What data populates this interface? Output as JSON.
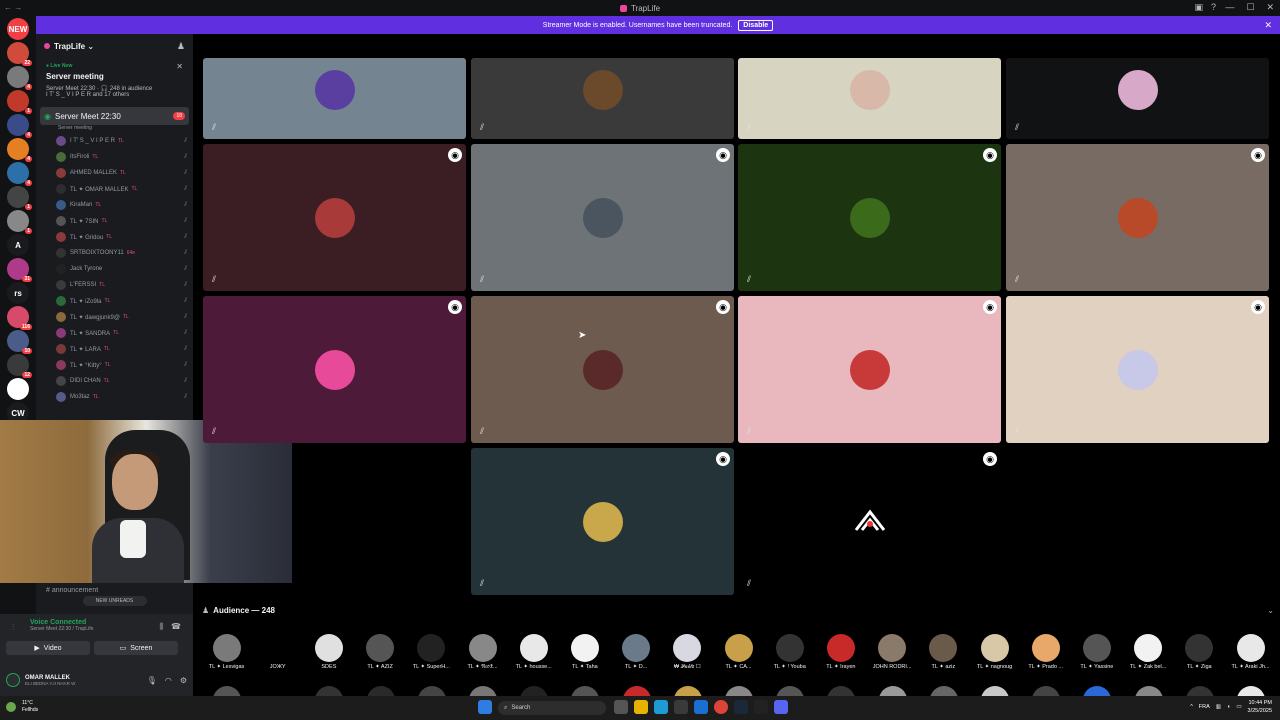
{
  "window": {
    "title": "TrapLife",
    "controls": [
      "—",
      "☐",
      "✕"
    ]
  },
  "streamer_banner": {
    "text": "Streamer Mode is enabled. Usernames have been truncated.",
    "button": "Disable"
  },
  "guilds": [
    {
      "label": "NEW",
      "color": "#f23f43"
    },
    {
      "label": "",
      "color": "#d14b3a",
      "badge": "22"
    },
    {
      "label": "",
      "color": "#7a7a7a",
      "badge": "4"
    },
    {
      "label": "",
      "color": "#c0392b",
      "badge": "1"
    },
    {
      "label": "",
      "color": "#3a4b8a",
      "badge": "4"
    },
    {
      "label": "",
      "color": "#e67e22",
      "badge": "4"
    },
    {
      "label": "",
      "color": "#2d6fa8",
      "badge": "4"
    },
    {
      "label": "",
      "color": "#444",
      "badge": "1"
    },
    {
      "label": "",
      "color": "#888",
      "badge": "1"
    },
    {
      "label": "A",
      "color": "#1a1b1e"
    },
    {
      "label": "",
      "color": "#b03a8a",
      "badge": "31"
    },
    {
      "label": "rs",
      "color": "#1a1b1e"
    },
    {
      "label": "",
      "color": "#d84a6a",
      "badge": "116"
    },
    {
      "label": "",
      "color": "#4a5d8a",
      "badge": "10"
    },
    {
      "label": "",
      "color": "#3a3a3a",
      "badge": "12"
    },
    {
      "label": "",
      "color": "#fff"
    },
    {
      "label": "CW",
      "color": "#1a1b1e"
    }
  ],
  "server": {
    "name": "TrapLife",
    "live_label": "Live Now",
    "live_title": "Server meeting",
    "live_info": "Server Meet 22:30 · 🎧 248 in audience",
    "live_users": "I T' S _ V I P E R and 17 others",
    "channel": {
      "name": "Server Meet 22:30",
      "sub": "Server meeting",
      "count": "18"
    },
    "members": [
      {
        "name": "I T' S _ V I P E R",
        "tag": "TL",
        "color": "#6b4a8a"
      },
      {
        "name": "ItsFiroli",
        "tag": "TL",
        "color": "#4a6b3a"
      },
      {
        "name": "AHMED MALLEK",
        "tag": "TL",
        "color": "#8a3a3a"
      },
      {
        "name": "TL ✦ OMAR MALLEK",
        "tag": "TL",
        "color": "#2b2d31"
      },
      {
        "name": "KiraMan",
        "tag": "TL",
        "color": "#3a5a8a"
      },
      {
        "name": "TL ✦ 7SIN",
        "tag": "TL",
        "color": "#555"
      },
      {
        "name": "TL ✦ Gridou",
        "tag": "TL",
        "color": "#8a3a3a"
      },
      {
        "name": "SRTBOIXTOONY11",
        "tag": "64e",
        "color": "#333"
      },
      {
        "name": "Jack Tyrone",
        "tag": "",
        "color": "#222"
      },
      {
        "name": "L'FERSSI",
        "tag": "TL",
        "color": "#3a3a3a"
      },
      {
        "name": "TL ✦ iZo9la",
        "tag": "TL",
        "color": "#2a6a3a"
      },
      {
        "name": "TL ✦ dawgjunk9@",
        "tag": "TL",
        "color": "#8a6a3a"
      },
      {
        "name": "TL ✦ SANDRA",
        "tag": "TL",
        "color": "#8a3a7a"
      },
      {
        "name": "TL ✦ LARA",
        "tag": "TL",
        "color": "#7a3a3a"
      },
      {
        "name": "TL ✦ °Kitty°",
        "tag": "TL",
        "color": "#8a3a5a"
      },
      {
        "name": "DIDI CHAN",
        "tag": "TL",
        "color": "#444"
      },
      {
        "name": "Mo3taz",
        "tag": "TL",
        "color": "#5a5a8a"
      }
    ],
    "announcement": "announcement",
    "new_unreads": "NEW UNREADS"
  },
  "voice": {
    "status": "Voice Connected",
    "location": "Server Meet 22:30 / TrapLife",
    "video_label": "Video",
    "screen_label": "Screen"
  },
  "user": {
    "name": "OMAR MALLEK",
    "status": "ELI BEDNA YJI NHAR W"
  },
  "stage_tiles": [
    {
      "bg": "#748591",
      "av": "#5a3fa0"
    },
    {
      "bg": "#3a3a3a",
      "av": "#6a4a2a"
    },
    {
      "bg": "#d8d4c2",
      "av": "#d8b8a8"
    },
    {
      "bg": "#111214",
      "av": "#d8a8c8"
    },
    {
      "bg": "#3a1e24",
      "av": "#a83a3a"
    },
    {
      "bg": "#6e7377",
      "av": "#4a5560"
    },
    {
      "bg": "#1d3410",
      "av": "#3a6a1a"
    },
    {
      "bg": "#776b64",
      "av": "#b84a2a"
    },
    {
      "bg": "#4e1a3a",
      "av": "#e84a9a"
    },
    {
      "bg": "#6e5b50",
      "av": "#5a2a2a"
    },
    {
      "bg": "#e9b8be",
      "av": "#c83a3a"
    },
    {
      "bg": "#e0d1c0",
      "av": "#c8c8e8"
    },
    {
      "bg": "#233337",
      "av": "#c8a84a"
    },
    {
      "bg": "#000000",
      "av": "#000000"
    }
  ],
  "audience": {
    "header": "Audience — 248",
    "members": [
      {
        "name": "TL ✦ Lesvigas",
        "color": "#7a7a7a"
      },
      {
        "name": "JOЖY",
        "color": "#000"
      },
      {
        "name": "SDES",
        "color": "#e0e0e0"
      },
      {
        "name": "TL ✦ AZIZ",
        "color": "#555"
      },
      {
        "name": "TL ✦ SuperH...",
        "color": "#222"
      },
      {
        "name": "TL ✦ 𝔑𝔢𝔬𝔛...",
        "color": "#888"
      },
      {
        "name": "TL ✦ housse...",
        "color": "#e8e8e8"
      },
      {
        "name": "TL ✦ Taha",
        "color": "#f2f2f2"
      },
      {
        "name": "TL ✦ D...",
        "color": "#6a7a8a"
      },
      {
        "name": "₩ 𝒫𝒶𝒷𝓁𝑜 ☐",
        "color": "#d8d8e0"
      },
      {
        "name": "TL ✦ CA...",
        "color": "#c8a04a"
      },
      {
        "name": "TL ✦ ! Youba",
        "color": "#333"
      },
      {
        "name": "TL ✦ Irayen",
        "color": "#c82a2a"
      },
      {
        "name": "JOHN RODRI...",
        "color": "#8a7a6a"
      },
      {
        "name": "TL ✦ aziz",
        "color": "#6a5a4a"
      },
      {
        "name": "TL ✦ nagnoug",
        "color": "#d8c8a8"
      },
      {
        "name": "TL ✦ Prado ...",
        "color": "#e8a86a"
      },
      {
        "name": "TL ✦ Yassine",
        "color": "#555"
      },
      {
        "name": "TL ✦ Zak bel...",
        "color": "#f2f2f2"
      },
      {
        "name": "TL ✦ Ziga",
        "color": "#333"
      },
      {
        "name": "TL ✦ Araki Jh...",
        "color": "#e8e8e8"
      }
    ]
  },
  "taskbar": {
    "weather_temp": "11°C",
    "weather_desc": "Fellhds",
    "search": "Search",
    "lang": "FRA",
    "time": "10:44 PM",
    "date": "3/25/2025"
  }
}
